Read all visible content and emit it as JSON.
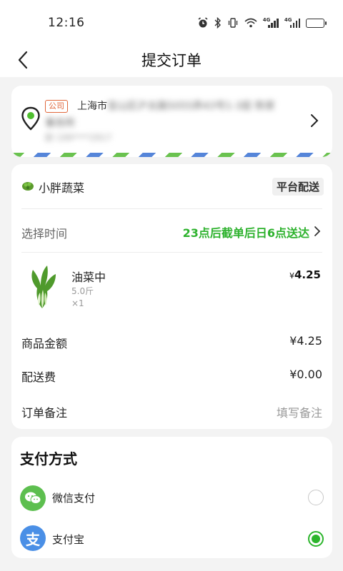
{
  "status_bar": {
    "time": "12:16",
    "network_label_1": "4G",
    "network_label_2": "4G",
    "icons": [
      "alarm-icon",
      "bluetooth-icon",
      "vibrate-icon",
      "wifi-icon",
      "signal-icon",
      "signal-icon",
      "battery-icon"
    ]
  },
  "nav": {
    "title": "提交订单"
  },
  "address": {
    "tag": "公司",
    "line1_visible": "上海市",
    "line1_blurred": "宝山区沪太路5055弄43号1-3层 陈家",
    "line2": "事务所",
    "phone": "尉 199****2917"
  },
  "order": {
    "store_name": "小胖蔬菜",
    "delivery_badge": "平台配送",
    "time_label": "选择时间",
    "time_value": "23点后截单后日6点送达",
    "product": {
      "name": "油菜中",
      "spec": "5.0斤",
      "qty": "×1",
      "currency": "¥",
      "price": "4.25"
    },
    "subtotal_label": "商品金额",
    "subtotal_value": "¥4.25",
    "shipping_label": "配送费",
    "shipping_value": "¥0.00",
    "note_label": "订单备注",
    "note_placeholder": "填写备注"
  },
  "payment": {
    "title": "支付方式",
    "options": [
      {
        "label": "微信支付",
        "selected": false
      },
      {
        "label": "支付宝",
        "selected": true
      }
    ],
    "alipay_glyph": "支"
  },
  "colors": {
    "accent_green": "#2db22d",
    "wechat_green": "#5dbf4f",
    "alipay_blue": "#4a8fe6",
    "tag_orange": "#e0663a"
  }
}
